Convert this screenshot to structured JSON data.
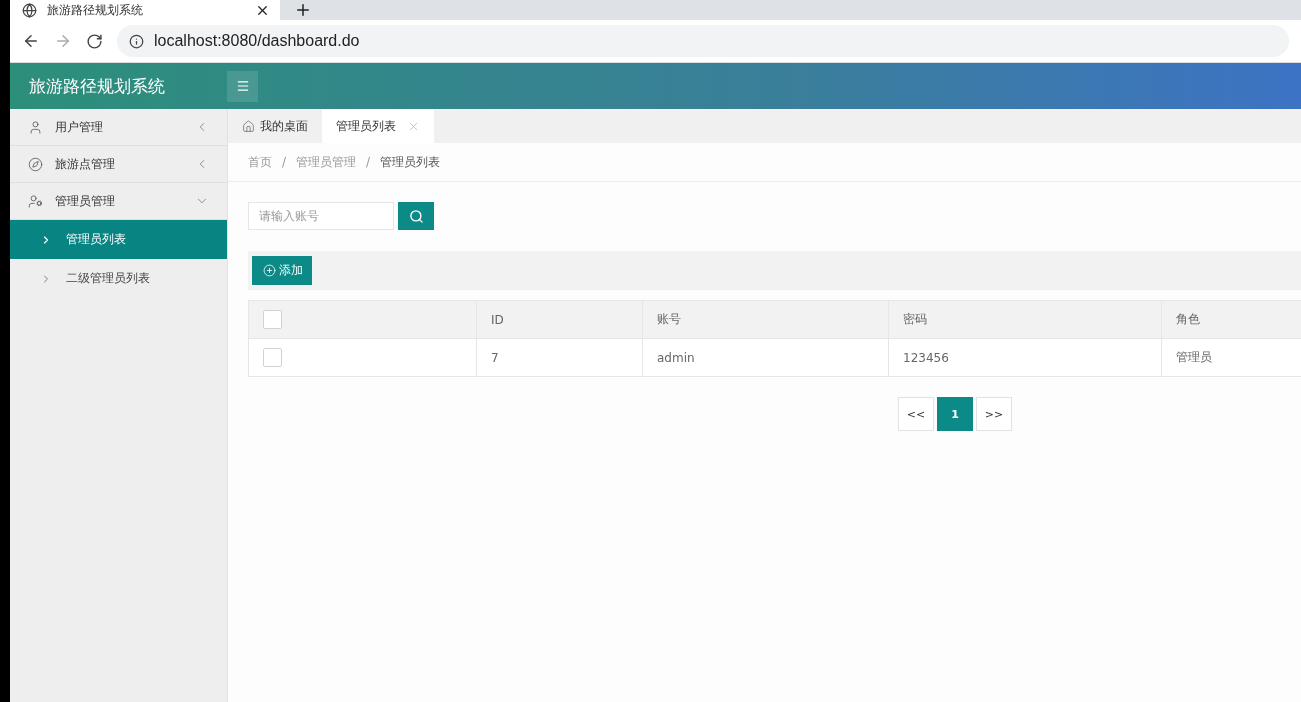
{
  "browser": {
    "tab_title": "旅游路径规划系统",
    "url": "localhost:8080/dashboard.do"
  },
  "header": {
    "title": "旅游路径规划系统"
  },
  "sidebar": {
    "items": [
      {
        "label": "用户管理",
        "kind": "user",
        "expanded": false
      },
      {
        "label": "旅游点管理",
        "kind": "compass",
        "expanded": false
      },
      {
        "label": "管理员管理",
        "kind": "admin",
        "expanded": true,
        "children": [
          {
            "label": "管理员列表",
            "selected": true
          },
          {
            "label": "二级管理员列表",
            "selected": false
          }
        ]
      }
    ]
  },
  "tabs": [
    {
      "label": "我的桌面",
      "kind": "home",
      "selected": false
    },
    {
      "label": "管理员列表",
      "kind": "closable",
      "selected": true
    }
  ],
  "breadcrumb": {
    "separator": "/",
    "items": [
      "首页",
      "管理员管理",
      "管理员列表"
    ]
  },
  "search": {
    "placeholder": "请输入账号"
  },
  "add_button": "添加",
  "table": {
    "header_checked": false,
    "columns": [
      "ID",
      "账号",
      "密码",
      "角色"
    ],
    "rows": [
      {
        "checked": false,
        "cells": [
          "7",
          "admin",
          "123456",
          "管理员"
        ]
      }
    ]
  },
  "pagination": {
    "prev": "<<",
    "pages": [
      {
        "label": "1",
        "selected": true
      }
    ],
    "next": ">>"
  }
}
